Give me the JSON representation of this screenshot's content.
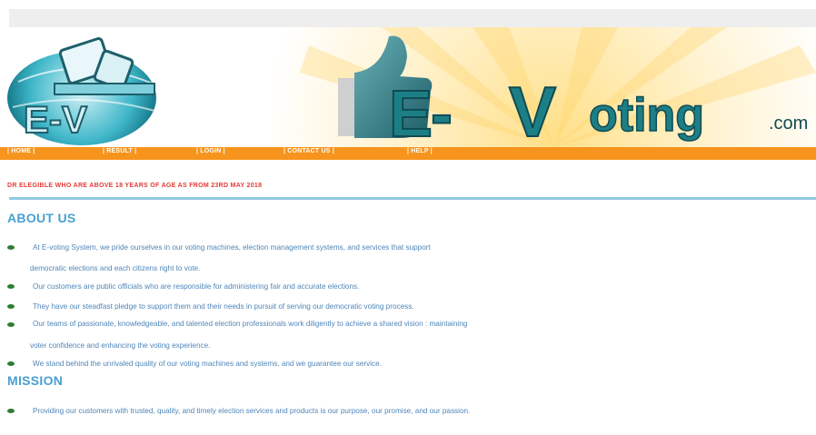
{
  "header": {
    "logo_letters": "E-V",
    "brand_main": "E-Voting",
    "brand_suffix": ".com"
  },
  "nav": {
    "items": [
      {
        "label": "| HOME |"
      },
      {
        "label": "| RESULT |"
      },
      {
        "label": "| LOGIN |"
      },
      {
        "label": "| CONTACT US |"
      },
      {
        "label": "| HELP |"
      }
    ]
  },
  "announcement": "DR ELEGIBLE WHO ARE ABOVE 18 YEARS OF AGE AS FROM 23RD MAY 2018",
  "about": {
    "title": "ABOUT US",
    "lines": [
      "At E-voting System, we pride ourselves in our voting machines, election management systems, and services that support",
      "democratic elections and each citizens right to vote.",
      "Our customers are public officials who are responsible for administering fair and accurate elections.",
      "They have our steadfast pledge to support them and their needs in pursuit of serving our democratic voting process.",
      "Our teams of passionate, knowledgeable, and talented election professionals work diligently to achieve a shared vision : maintaining",
      "voter confidence and enhancing the voting experience.",
      "We stand behind the unrivaled quality of our voting machines and systems, and we guarantee our service."
    ]
  },
  "mission": {
    "title": "MISSION",
    "lines": [
      "Providing our customers with trusted, quality, and timely election services and products is our purpose, our promise, and our passion."
    ]
  },
  "colors": {
    "nav_bg": "#f7941d",
    "heading": "#4a9fd0",
    "body_text": "#4f86b8",
    "announcement": "#e53935",
    "bullet": "#2e7d32",
    "brand_teal": "#1d7f86"
  }
}
